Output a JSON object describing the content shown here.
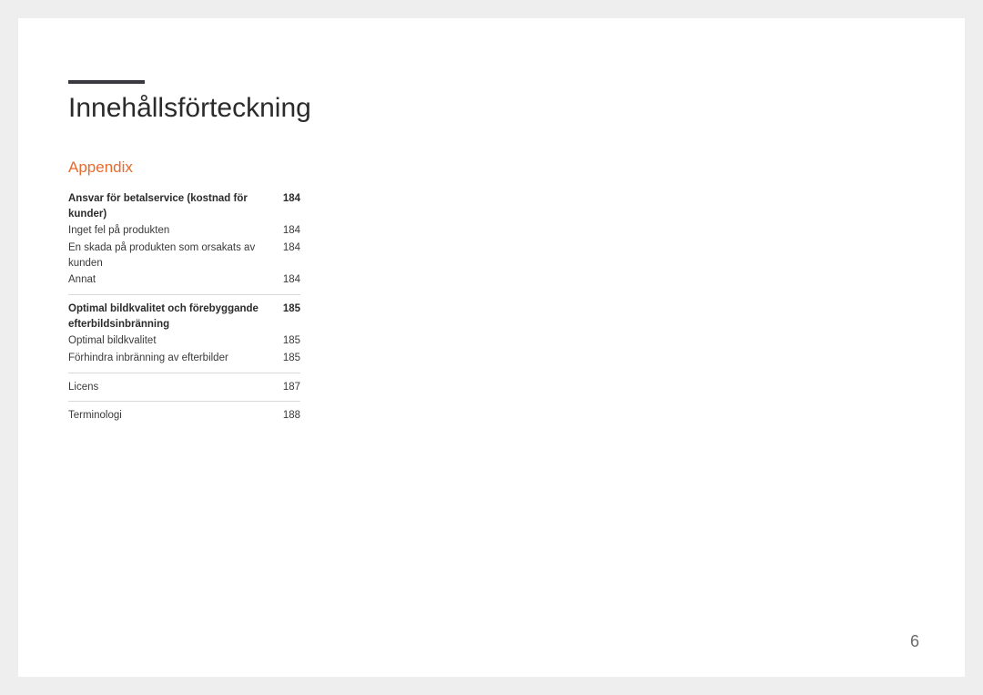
{
  "title": "Innehållsförteckning",
  "section": "Appendix",
  "pageNumber": "6",
  "entries": [
    {
      "label": "Ansvar för betalservice (kostnad för kunder)",
      "page": "184",
      "bold": true
    },
    {
      "label": "Inget fel på produkten",
      "page": "184",
      "bold": false
    },
    {
      "label": "En skada på produkten som orsakats av kunden",
      "page": "184",
      "bold": false
    },
    {
      "label": "Annat",
      "page": "184",
      "bold": false
    },
    {
      "separator": true
    },
    {
      "label": "Optimal bildkvalitet och förebyggande efterbildsinbränning",
      "page": "185",
      "bold": true
    },
    {
      "label": "Optimal bildkvalitet",
      "page": "185",
      "bold": false
    },
    {
      "label": "Förhindra inbränning av efterbilder",
      "page": "185",
      "bold": false
    },
    {
      "separator": true
    },
    {
      "label": "Licens",
      "page": "187",
      "bold": false
    },
    {
      "separator": true
    },
    {
      "label": "Terminologi",
      "page": "188",
      "bold": false
    }
  ]
}
